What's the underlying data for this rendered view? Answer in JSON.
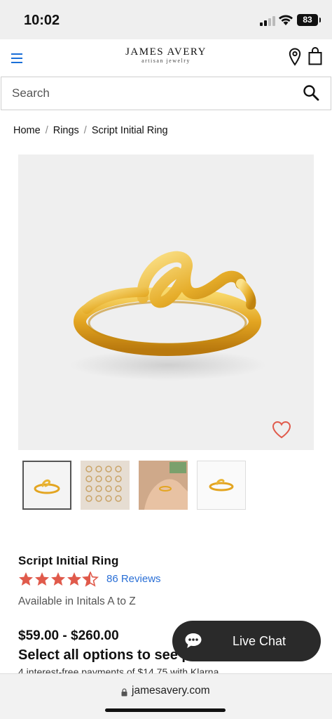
{
  "status_bar": {
    "time": "10:02",
    "battery": "83",
    "icons": [
      "signal-icon",
      "wifi-icon",
      "battery-icon"
    ]
  },
  "header": {
    "logo_main": "JAMES AVERY",
    "logo_sub": "artisan jewelry",
    "icons": [
      "menu-icon",
      "location-pin-icon",
      "shopping-bag-icon"
    ],
    "accent_color": "#1a6fd8"
  },
  "search": {
    "placeholder": "Search",
    "value": ""
  },
  "breadcrumb": {
    "items": [
      "Home",
      "Rings",
      "Script Initial Ring"
    ],
    "separator": "/"
  },
  "product": {
    "title": "Script Initial Ring",
    "rating": 4.5,
    "rating_max": 5,
    "star_color": "#e05a4b",
    "reviews_label": "86 Reviews",
    "availability": "Available in Initals A to Z",
    "price": "$59.00 - $260.00",
    "select_options": "Select all options to see price",
    "klarna": "4 interest-free payments of $14.75 with Klarna.",
    "favorite_icon": "heart-icon",
    "thumbnails": [
      "thumbnail-ring-front",
      "thumbnail-ring-alphabet-grid",
      "thumbnail-ring-on-hand",
      "thumbnail-ring-angle"
    ]
  },
  "live_chat": {
    "label": "Live Chat",
    "icon": "chat-bubble-icon"
  },
  "browser": {
    "url": "jamesavery.com",
    "icon": "lock-icon"
  }
}
